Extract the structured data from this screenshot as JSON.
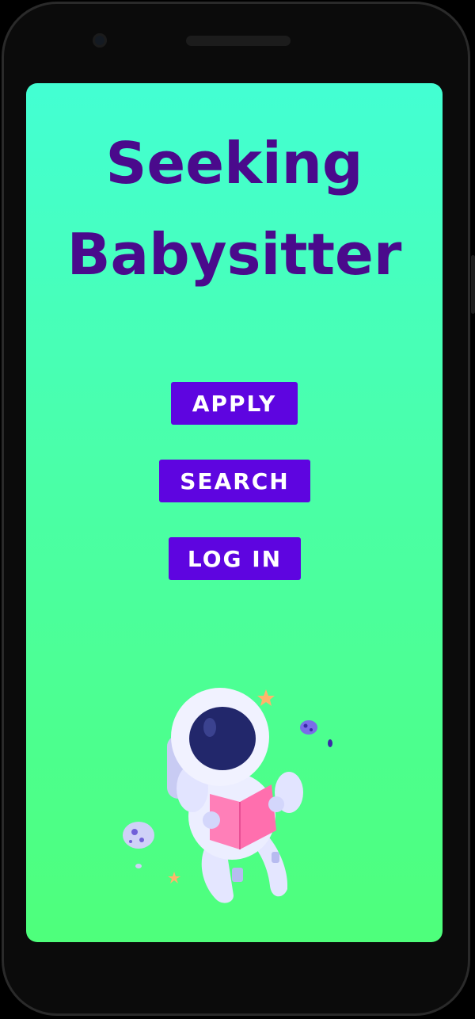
{
  "app": {
    "title_line1": "Seeking",
    "title_line2": "Babysitter"
  },
  "actions": {
    "apply_label": "APPLY",
    "search_label": "SEARCH",
    "login_label": "LOG IN"
  },
  "colors": {
    "title": "#4a0a8c",
    "button_bg": "#5e05e0",
    "button_text": "#ffffff",
    "gradient_top": "#43ffd3",
    "gradient_bottom": "#4eff7b"
  },
  "illustration": {
    "icon": "astronaut-reading-book-icon"
  }
}
